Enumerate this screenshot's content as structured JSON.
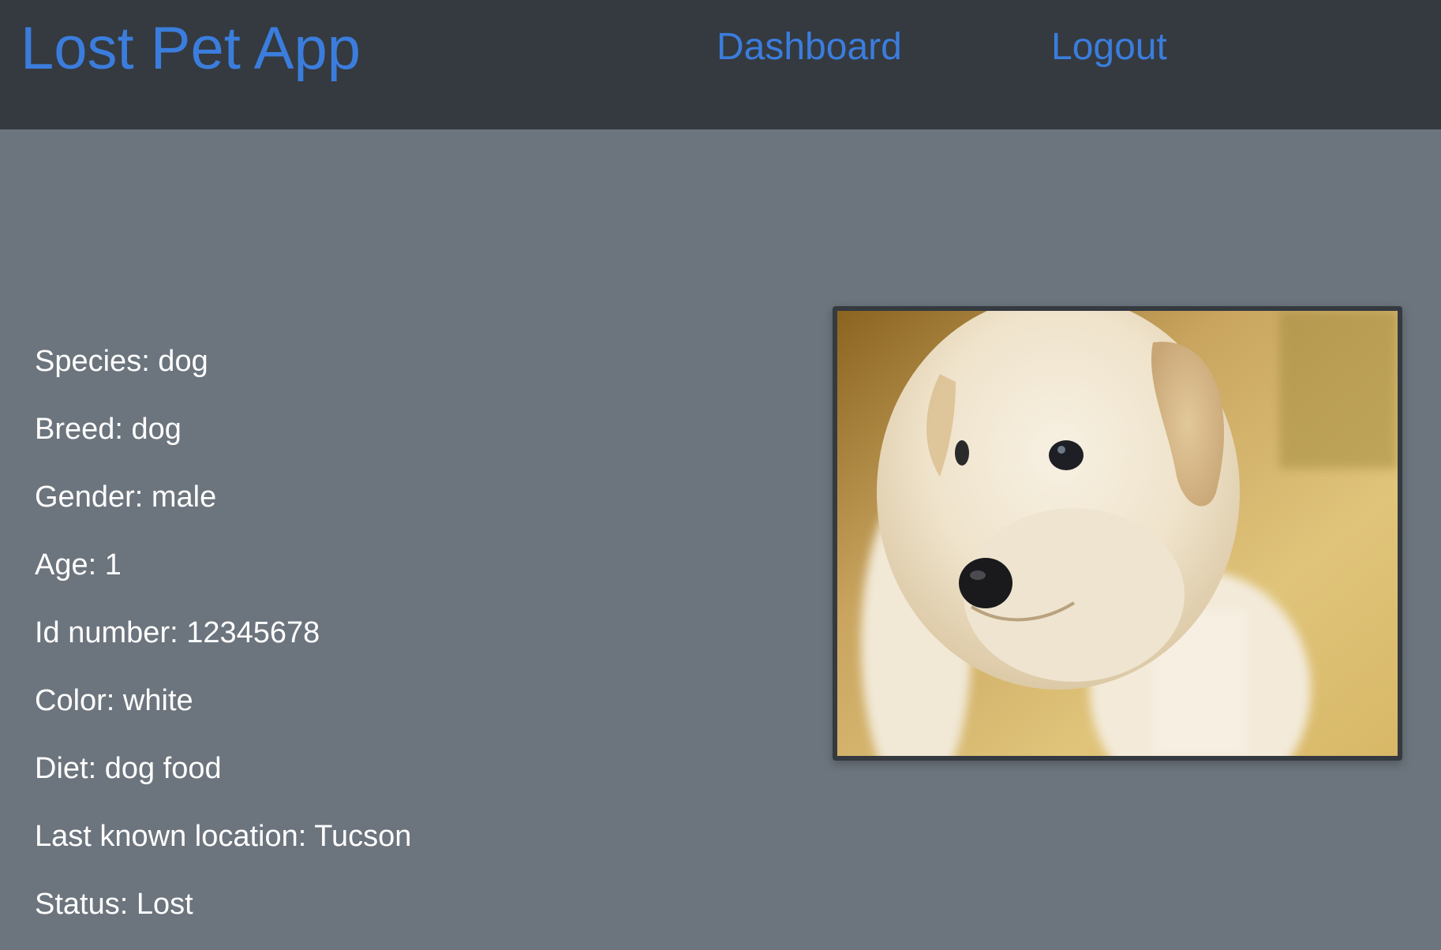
{
  "navbar": {
    "brand": "Lost Pet App",
    "links": [
      {
        "label": "Dashboard"
      },
      {
        "label": "Logout"
      }
    ]
  },
  "pet": {
    "details": [
      {
        "text": "Species: dog"
      },
      {
        "text": "Breed: dog"
      },
      {
        "text": "Gender: male"
      },
      {
        "text": "Age: 1"
      },
      {
        "text": "Id number: 12345678"
      },
      {
        "text": "Color: white"
      },
      {
        "text": "Diet: dog food"
      },
      {
        "text": "Last known location: Tucson"
      },
      {
        "text": "Status: Lost"
      }
    ],
    "photo": {
      "subject": "white-labrador-puppy"
    }
  },
  "colors": {
    "navbar_bg": "#343a40",
    "page_bg": "#6c747d",
    "link": "#3b7ddd",
    "text": "#ffffff"
  }
}
